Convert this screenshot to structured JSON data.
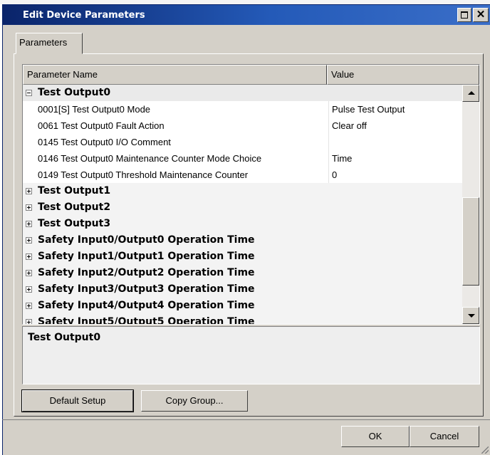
{
  "window": {
    "title": "Edit Device Parameters",
    "close_glyph": "✕"
  },
  "tabs": [
    {
      "label": "Parameters",
      "active": true
    }
  ],
  "table": {
    "columns": [
      "Parameter Name",
      "Value"
    ],
    "rows": [
      {
        "type": "group",
        "label": "Test Output0",
        "expanded": true
      },
      {
        "type": "param",
        "name": "0001[S] Test Output0 Mode",
        "value": "Pulse Test Output"
      },
      {
        "type": "param",
        "name": "0061 Test Output0 Fault Action",
        "value": "Clear off"
      },
      {
        "type": "param",
        "name": "0145 Test Output0 I/O Comment",
        "value": ""
      },
      {
        "type": "param",
        "name": "0146 Test Output0 Maintenance Counter Mode Choice",
        "value": "Time"
      },
      {
        "type": "param",
        "name": "0149 Test Output0 Threshold Maintenance Counter",
        "value": "0"
      },
      {
        "type": "group",
        "label": "Test Output1",
        "expanded": false
      },
      {
        "type": "group",
        "label": "Test Output2",
        "expanded": false
      },
      {
        "type": "group",
        "label": "Test Output3",
        "expanded": false
      },
      {
        "type": "group",
        "label": "Safety Input0/Output0 Operation Time",
        "expanded": false
      },
      {
        "type": "group",
        "label": "Safety Input1/Output1 Operation Time",
        "expanded": false
      },
      {
        "type": "group",
        "label": "Safety Input2/Output2 Operation Time",
        "expanded": false
      },
      {
        "type": "group",
        "label": "Safety Input3/Output3 Operation Time",
        "expanded": false
      },
      {
        "type": "group",
        "label": "Safety Input4/Output4 Operation Time",
        "expanded": false
      },
      {
        "type": "group",
        "label": "Safety Input5/Output5 Operation Time",
        "expanded": false
      }
    ]
  },
  "description": {
    "title": "Test Output0"
  },
  "buttons": {
    "default_setup": "Default Setup",
    "copy_group": "Copy Group...",
    "ok": "OK",
    "cancel": "Cancel"
  }
}
